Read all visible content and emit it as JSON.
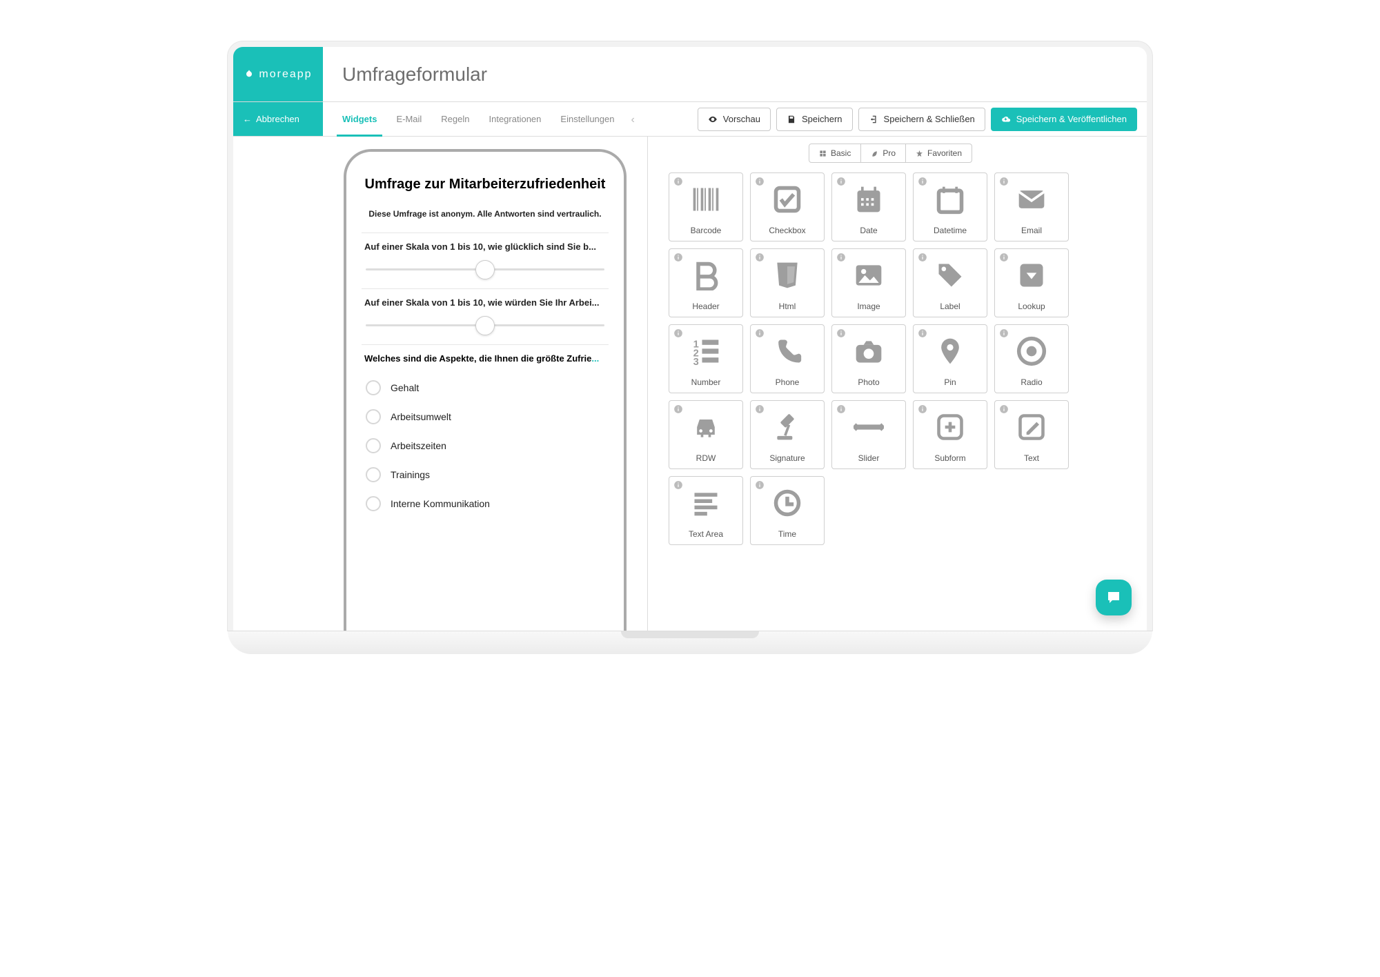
{
  "brand": "moreapp",
  "page_title": "Umfrageformular",
  "cancel_label": "Abbrechen",
  "tabs": [
    "Widgets",
    "E-Mail",
    "Regeln",
    "Integrationen",
    "Einstellungen"
  ],
  "active_tab": 0,
  "actions": {
    "preview": "Vorschau",
    "save": "Speichern",
    "save_close": "Speichern & Schließen",
    "save_publish": "Speichern & Veröffentlichen"
  },
  "form_preview": {
    "title": "Umfrage zur Mitarbeiterzufriedenheit",
    "subtitle": "Diese Umfrage ist anonym. Alle Antworten sind vertraulich.",
    "slider1_label": "Auf einer Skala von 1 bis 10, wie glücklich sind Sie b...",
    "slider2_label": "Auf einer Skala von 1 bis 10, wie würden Sie Ihr Arbei...",
    "radio_label": "Welches sind die Aspekte, die Ihnen die größte Zufrie",
    "radio_label_tail": "...",
    "options": [
      "Gehalt",
      "Arbeitsumwelt",
      "Arbeitszeiten",
      "Trainings",
      "Interne Kommunikation"
    ]
  },
  "palette_filters": {
    "basic": "Basic",
    "pro": "Pro",
    "favorites": "Favoriten"
  },
  "widgets": [
    {
      "id": "barcode",
      "label": "Barcode",
      "icon": "barcode"
    },
    {
      "id": "checkbox",
      "label": "Checkbox",
      "icon": "checkbox"
    },
    {
      "id": "date",
      "label": "Date",
      "icon": "calendar-grid"
    },
    {
      "id": "datetime",
      "label": "Datetime",
      "icon": "calendar-empty"
    },
    {
      "id": "email",
      "label": "Email",
      "icon": "envelope"
    },
    {
      "id": "header",
      "label": "Header",
      "icon": "bold"
    },
    {
      "id": "html",
      "label": "Html",
      "icon": "html5"
    },
    {
      "id": "image",
      "label": "Image",
      "icon": "image"
    },
    {
      "id": "label",
      "label": "Label",
      "icon": "tag"
    },
    {
      "id": "lookup",
      "label": "Lookup",
      "icon": "dropdown"
    },
    {
      "id": "number",
      "label": "Number",
      "icon": "number-list"
    },
    {
      "id": "phone",
      "label": "Phone",
      "icon": "phone"
    },
    {
      "id": "photo",
      "label": "Photo",
      "icon": "camera"
    },
    {
      "id": "pin",
      "label": "Pin",
      "icon": "pin"
    },
    {
      "id": "radio",
      "label": "Radio",
      "icon": "radio"
    },
    {
      "id": "rdw",
      "label": "RDW",
      "icon": "car"
    },
    {
      "id": "signature",
      "label": "Signature",
      "icon": "gavel"
    },
    {
      "id": "slider",
      "label": "Slider",
      "icon": "slider"
    },
    {
      "id": "subform",
      "label": "Subform",
      "icon": "plus-square"
    },
    {
      "id": "text",
      "label": "Text",
      "icon": "edit"
    },
    {
      "id": "textarea",
      "label": "Text Area",
      "icon": "align-left"
    },
    {
      "id": "time",
      "label": "Time",
      "icon": "clock"
    }
  ]
}
